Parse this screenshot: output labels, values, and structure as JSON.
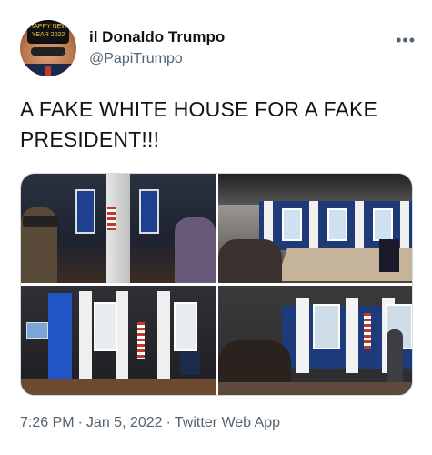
{
  "tweet": {
    "display_name": "il Donaldo Trumpo",
    "handle": "@PapiTrumpo",
    "avatar_hat_text": "HAPPY NEW YEAR 2022",
    "more_icon": "more-horizontal-icon",
    "text": "A FAKE WHITE HOUSE FOR A FAKE PRESIDENT!!!",
    "time": "7:26 PM",
    "date": "Jan 5, 2022",
    "source": "Twitter Web App"
  },
  "colors": {
    "text_primary": "#0f1419",
    "text_secondary": "#536471",
    "border": "#cfd9de"
  }
}
